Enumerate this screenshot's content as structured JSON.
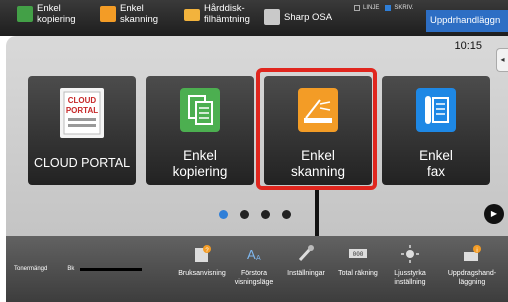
{
  "topbar": {
    "items": [
      {
        "label": "Enkel\nkopiering",
        "color": "#43a047"
      },
      {
        "label": "Enkel\nskanning",
        "color": "#f39c26"
      },
      {
        "label": "Hårddisk-\nfilhämtning",
        "color": "#f2b33d"
      },
      {
        "label": "Sharp OSA",
        "color": "#c9c9c9"
      }
    ],
    "status_line": "LINJE",
    "status_print": "SKRIV.",
    "jobs_label": "Uppdrhandläggn"
  },
  "clock": "10:15",
  "tiles": [
    {
      "label": "CLOUD PORTAL",
      "icon": "cloud-portal-icon",
      "color": "#c62828",
      "icon_text": "CLOUD\nPORTAL"
    },
    {
      "label": "Enkel\nkopiering",
      "icon": "copy-icon",
      "color": "#4caf50"
    },
    {
      "label": "Enkel\nskanning",
      "icon": "scan-icon",
      "color": "#f39c26"
    },
    {
      "label": "Enkel\nfax",
      "icon": "fax-icon",
      "color": "#1e88e5"
    }
  ],
  "pagination": {
    "pages": 4,
    "current": 1
  },
  "bottombar": {
    "toner_label": "Tonermängd",
    "toner_color": "Bk",
    "buttons": [
      {
        "label": "Bruksanvisning",
        "icon": "manual-icon"
      },
      {
        "label": "Förstora\nvisningsläge",
        "icon": "zoom-text-icon"
      },
      {
        "label": "Inställningar",
        "icon": "settings-icon"
      },
      {
        "label": "Total räkning",
        "icon": "counter-icon"
      },
      {
        "label": "Ljusstyrka\ninställning",
        "icon": "brightness-icon"
      },
      {
        "label": "Uppdragshand-\nläggning",
        "icon": "job-status-icon"
      }
    ]
  }
}
